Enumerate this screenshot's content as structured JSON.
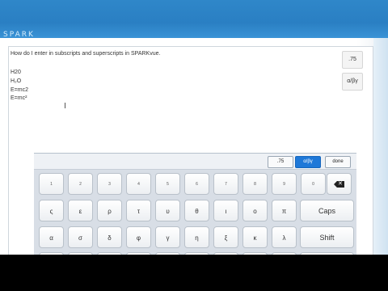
{
  "topbar": {
    "logo_text": "SPARK"
  },
  "notes": {
    "question": "How do I enter in subscripts and superscripts in SPARKvue.",
    "lines": [
      "H20",
      "H₂O",
      "E=mc2",
      "E=mc²"
    ]
  },
  "side_buttons": {
    "decimal": ".75",
    "greek": "α/βγ"
  },
  "keyboard": {
    "toolbar": {
      "decimal": ".75",
      "greek": "α/βγ",
      "done": "done"
    },
    "row1": [
      "1",
      "2",
      "3",
      "4",
      "5",
      "6",
      "7",
      "8",
      "9",
      "0"
    ],
    "row2": [
      "ς",
      "ε",
      "ρ",
      "τ",
      "υ",
      "θ",
      "ι",
      "ο",
      "π"
    ],
    "row2_wide": "Caps",
    "row3": [
      "α",
      "σ",
      "δ",
      "φ",
      "γ",
      "η",
      "ξ",
      "κ",
      "λ"
    ],
    "row3_wide": "Shift",
    "backspace_icon": "backspace-icon"
  }
}
